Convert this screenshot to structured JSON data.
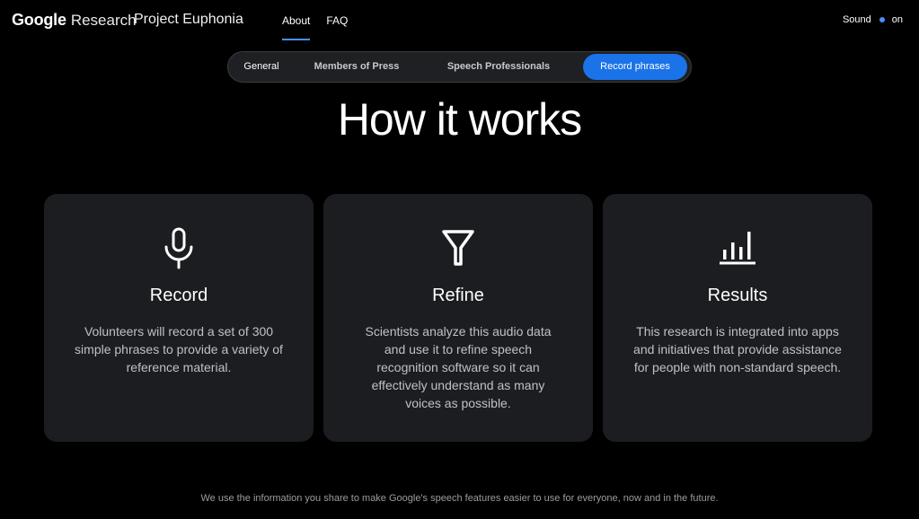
{
  "header": {
    "brand_google": "Google",
    "brand_research": "Research",
    "project_title": "Project Euphonia",
    "nav": [
      {
        "label": "About",
        "active": true
      },
      {
        "label": "FAQ",
        "active": false
      }
    ],
    "sound_label": "Sound",
    "sound_state": "on"
  },
  "tabs": [
    {
      "label": "General",
      "selected": false
    },
    {
      "label": "Members of Press",
      "selected": false
    },
    {
      "label": "Speech Professionals",
      "selected": false
    },
    {
      "label": "Record phrases",
      "selected": true
    }
  ],
  "main": {
    "title": "How it works",
    "cards": [
      {
        "icon": "microphone-icon",
        "title": "Record",
        "description": "Volunteers will record a set of 300 simple phrases to provide a variety of reference material."
      },
      {
        "icon": "filter-icon",
        "title": "Refine",
        "description": "Scientists analyze this audio data and use it to refine speech recognition software so it can effectively understand as many voices as possible."
      },
      {
        "icon": "bar-chart-icon",
        "title": "Results",
        "description": "This research is integrated into apps and initiatives that provide assistance for people with non-standard speech."
      }
    ]
  },
  "footer": {
    "note": "We use the information you share to make Google's speech features easier to use for everyone, now and in the future."
  },
  "colors": {
    "accent": "#1a73e8",
    "indicator": "#4c8df6",
    "background": "#000000",
    "card": "#1c1d20"
  }
}
